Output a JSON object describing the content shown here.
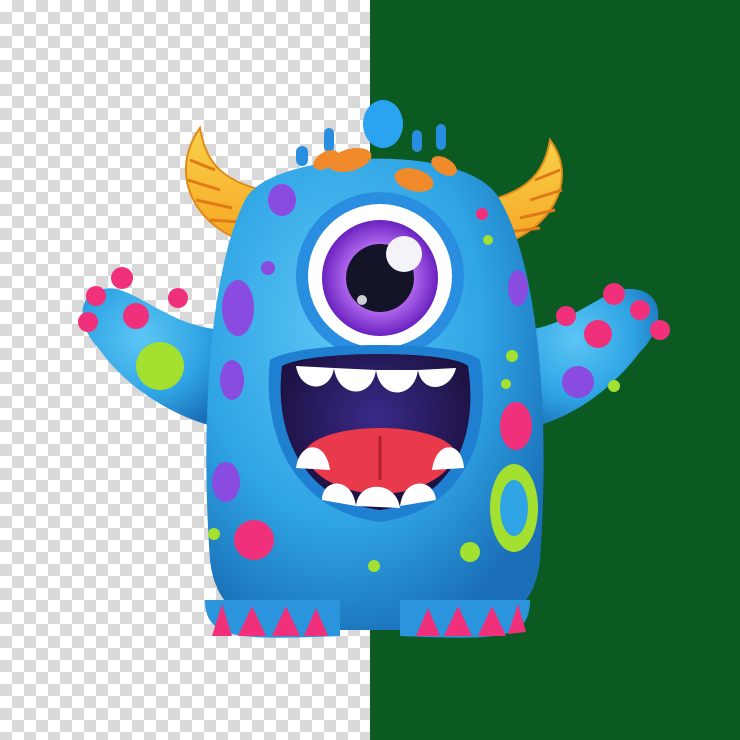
{
  "scene": {
    "left_background": "transparency-checkerboard",
    "right_background_color": "#0b5a22",
    "subject": "monster-figure"
  },
  "palette": {
    "body": "#2fa4e4",
    "body_shadow": "#1a6fb8",
    "horn": "#f6a623",
    "horn_tip": "#f9d24a",
    "eye_iris": "#7b2fd0",
    "mouth": "#2a1a5a",
    "tongue": "#e83a4a",
    "teeth": "#ffffff",
    "spot_orange": "#f08a2a",
    "spot_purple": "#8a4be0",
    "spot_pink": "#f0307a",
    "spot_green": "#a4e030"
  },
  "icons": {
    "monster": "monster-icon"
  }
}
